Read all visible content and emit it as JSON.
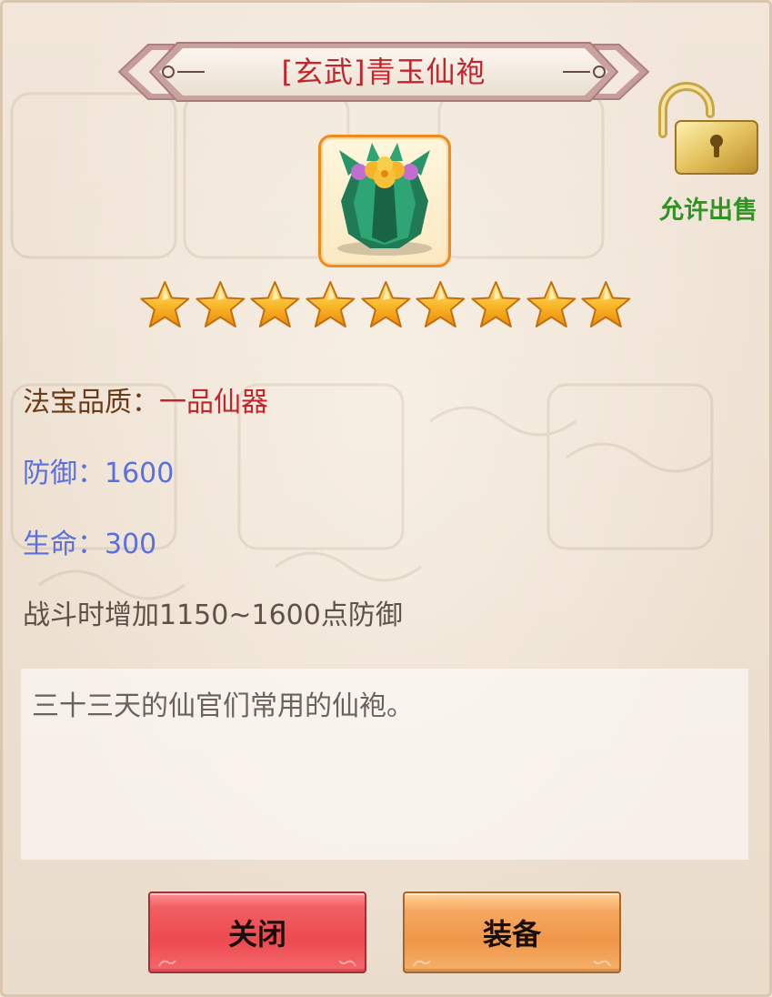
{
  "title": "[玄武]青玉仙袍",
  "lock": {
    "icon": "unlocked-padlock-icon",
    "label": "允许出售"
  },
  "item": {
    "icon": "green-robe-icon",
    "frame_color": "#f08a1d"
  },
  "stars": {
    "count": 9,
    "icon": "star-icon"
  },
  "stats": {
    "quality_label": "法宝品质：",
    "quality_value": "一品仙器",
    "defense": "防御：1600",
    "life": "生命：300",
    "effect": "战斗时增加1150~1600点防御"
  },
  "description": "三十三天的仙官们常用的仙袍。",
  "buttons": {
    "close_label": "关闭",
    "equip_label": "装备"
  },
  "colors": {
    "title": "#c0262b",
    "sale_label": "#2f9421",
    "stat_blue": "#5a6fe0",
    "quality_value": "#c0262b"
  }
}
